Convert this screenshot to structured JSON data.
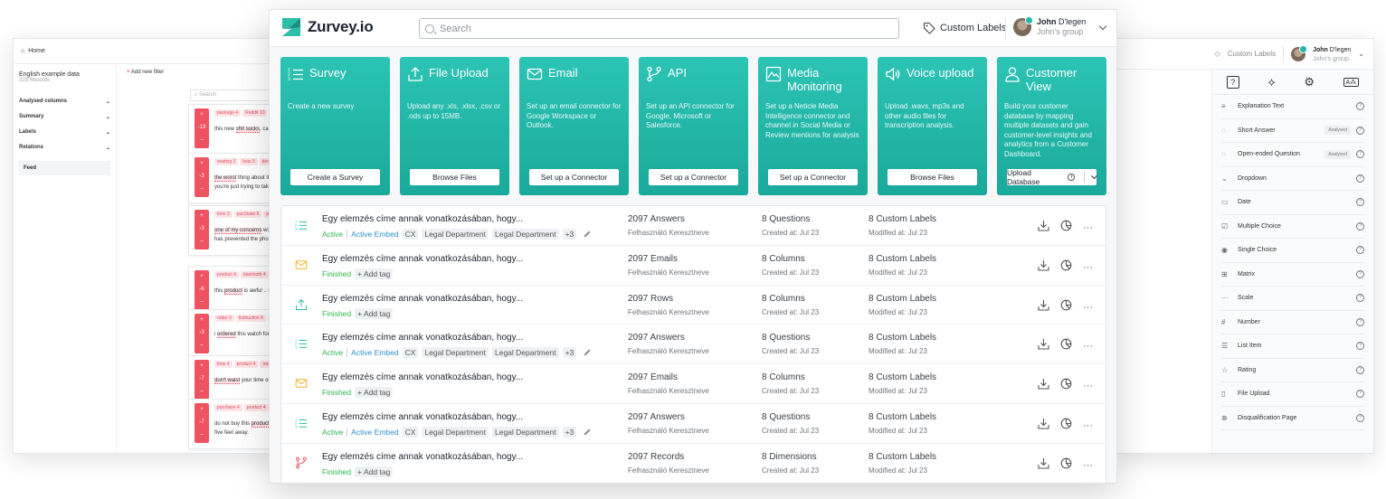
{
  "colors": {
    "accent": "#1fb5a5",
    "active": "#2db84b",
    "embed": "#2b8fd6",
    "danger": "#ef5361"
  },
  "left_window": {
    "home": "Home",
    "dataset_name": "English example data",
    "dataset_count": "329 Records",
    "sections": [
      "Analysed columns",
      "Summary",
      "Labels",
      "Relations"
    ],
    "feed": "Feed",
    "add_filter": "Add new filter",
    "search_placeholder": "Search",
    "cards": [
      {
        "score": [
          "+",
          "-13",
          "–"
        ],
        "tags": [
          "package 4",
          "Reddit 10"
        ],
        "text": [
          "this new ",
          "shit sucks",
          ", can rea"
        ]
      },
      {
        "score": [
          "+",
          "-3",
          "–"
        ],
        "tags": [
          "seating 3",
          "loos 3",
          "downs"
        ],
        "text": [
          "the worst",
          " thing about it, the",
          "you're just trying to take it in"
        ]
      },
      {
        "score": [
          "+",
          "-3",
          "–"
        ],
        "tags": [
          "time 3",
          "purchase 6",
          "phon"
        ],
        "text": [
          "one of my concerns",
          " with th",
          "durable than my other phon",
          "has prevented the phone fr"
        ]
      },
      {
        "score": [
          "+",
          "-6",
          "–"
        ],
        "tags": [
          "product 4",
          "bluetooth 4",
          "d"
        ],
        "text": [
          "this ",
          "product",
          " is awful .. it do"
        ]
      },
      {
        "score": [
          "+",
          "-3",
          "–"
        ],
        "tags": [
          "order 3",
          "instruction 4",
          "fou"
        ],
        "text": [
          "i ",
          "ordered",
          " this watch for my f"
        ]
      },
      {
        "score": [
          "+",
          "-7",
          "–"
        ],
        "tags": [
          "time 4",
          "product 4",
          "money"
        ],
        "text": [
          "don't waist",
          " your ",
          "time",
          " or mo"
        ]
      },
      {
        "score": [
          "+",
          "-7",
          "–"
        ],
        "tags": [
          "purchase 4",
          "product 4",
          "je"
        ],
        "text": [
          "do not buy this ",
          "product!!",
          " c",
          "five feet away."
        ]
      }
    ]
  },
  "right_window": {
    "custom_labels": "Custom Labels",
    "user_first": "John",
    "user_last": "D'legen",
    "user_group": "John's group",
    "items": [
      {
        "icon": "≡",
        "label": "Explanation Text",
        "badge": ""
      },
      {
        "icon": "◌",
        "label": "Short Answer",
        "badge": "Analysed"
      },
      {
        "icon": "◌",
        "label": "Open-ended Question",
        "badge": "Analysed"
      },
      {
        "icon": "⌄",
        "label": "Dropdown",
        "badge": ""
      },
      {
        "icon": "▭",
        "label": "Date",
        "badge": ""
      },
      {
        "icon": "☑",
        "label": "Multiple Choice",
        "badge": ""
      },
      {
        "icon": "◉",
        "label": "Single Choice",
        "badge": ""
      },
      {
        "icon": "⊞",
        "label": "Matrix",
        "badge": ""
      },
      {
        "icon": "···",
        "label": "Scale",
        "badge": ""
      },
      {
        "icon": "#",
        "label": "Number",
        "badge": ""
      },
      {
        "icon": "☰",
        "label": "List Item",
        "badge": ""
      },
      {
        "icon": "☆",
        "label": "Rating",
        "badge": ""
      },
      {
        "icon": "▯",
        "label": "File Upload",
        "badge": ""
      },
      {
        "icon": "⊗",
        "label": "Disqualification Page",
        "badge": ""
      }
    ]
  },
  "header": {
    "logo": "Zurvey.io",
    "search_placeholder": "Search",
    "custom_labels": "Custom Labels",
    "user_first": "John",
    "user_last": " D'legen",
    "user_group": "John's group"
  },
  "tiles": [
    {
      "icon": "list-icon",
      "title": "Survey",
      "desc": "Create a new survey",
      "button": "Create a Survey"
    },
    {
      "icon": "upload-icon",
      "title": "File Upload",
      "desc": "Upload any .xls, .xlsx, .csv or .ods up to 15MB.",
      "button": "Browse Files"
    },
    {
      "icon": "mail-icon",
      "title": "Email",
      "desc": "Set up an email connector for Google Workspace or Outlook.",
      "button": "Set up a Connector"
    },
    {
      "icon": "api-icon",
      "title": "API",
      "desc": "Set up an API connector for Google, Microsoft or Salesforce.",
      "button": "Set up a Connector"
    },
    {
      "icon": "media-icon",
      "title": "Media Monitoring",
      "desc": "Set up a Neticle Media Intelligence connector and channel in Social Media or Review mentions for analysis",
      "button": "Set up a Connector"
    },
    {
      "icon": "voice-icon",
      "title": "Voice upload",
      "desc": "Upload .wavs, mp3s and other audio files for transcription analysis.",
      "button": "Browse Files"
    },
    {
      "icon": "customer-icon",
      "title": "Customer View",
      "desc": "Build your customer database by mapping multiple datasets and gain customer-level insights and analytics from a Customer Dashboard.",
      "button": "Upload Database"
    }
  ],
  "rows": [
    {
      "icon": "list-icon",
      "title": "Egy elemzés címe annak vonatkozásában, hogy...",
      "status": "Active",
      "embed": "Active Embed",
      "tags": [
        "CX",
        "Legal Department",
        "Legal Department"
      ],
      "more_tags": "+3",
      "add_tag": "",
      "count": "2097 Answers",
      "owner": "Felhasználó Keresztneve",
      "dims": "8 Questions",
      "created": "Created at: Jul 23",
      "labels": "8 Custom Labels",
      "modified": "Modified at: Jul 23"
    },
    {
      "icon": "mail-icon",
      "title": "Egy elemzés címe annak vonatkozásában, hogy...",
      "status": "Finished",
      "embed": "",
      "tags": [],
      "more_tags": "",
      "add_tag": "+ Add tag",
      "count": "2097 Emails",
      "owner": "Felhasználó Keresztneve",
      "dims": "8 Columns",
      "created": "Created at: Jul 23",
      "labels": "8 Custom Labels",
      "modified": "Modified at: Jul 23"
    },
    {
      "icon": "upload-icon",
      "title": "Egy elemzés címe annak vonatkozásában, hogy...",
      "status": "Finished",
      "embed": "",
      "tags": [],
      "more_tags": "",
      "add_tag": "+ Add tag",
      "count": "2097 Rows",
      "owner": "Felhasználó Keresztneve",
      "dims": "8 Columns",
      "created": "Created at: Jul 23",
      "labels": "8 Custom Labels",
      "modified": "Modified at: Jul 23"
    },
    {
      "icon": "list-icon",
      "title": "Egy elemzés címe annak vonatkozásában, hogy...",
      "status": "Active",
      "embed": "Active Embed",
      "tags": [
        "CX",
        "Legal Department",
        "Legal Department"
      ],
      "more_tags": "+3",
      "add_tag": "",
      "count": "2097 Answers",
      "owner": "Felhasználó Keresztneve",
      "dims": "8 Questions",
      "created": "Created at: Jul 23",
      "labels": "8 Custom Labels",
      "modified": "Modified at: Jul 23"
    },
    {
      "icon": "mail-icon",
      "title": "Egy elemzés címe annak vonatkozásában, hogy...",
      "status": "Finished",
      "embed": "",
      "tags": [],
      "more_tags": "",
      "add_tag": "+ Add tag",
      "count": "2097 Emails",
      "owner": "Felhasználó Keresztneve",
      "dims": "8 Columns",
      "created": "Created at: Jul 23",
      "labels": "8 Custom Labels",
      "modified": "Modified at: Jul 23"
    },
    {
      "icon": "list-icon",
      "title": "Egy elemzés címe annak vonatkozásában, hogy...",
      "status": "Active",
      "embed": "Active Embed",
      "tags": [
        "CX",
        "Legal Department",
        "Legal Department"
      ],
      "more_tags": "+3",
      "add_tag": "",
      "count": "2097 Answers",
      "owner": "Felhasználó Keresztneve",
      "dims": "8 Questions",
      "created": "Created at: Jul 23",
      "labels": "8 Custom Labels",
      "modified": "Modified at: Jul 23"
    },
    {
      "icon": "api-icon",
      "title": "Egy elemzés címe annak vonatkozásában, hogy...",
      "status": "Finished",
      "embed": "",
      "tags": [],
      "more_tags": "",
      "add_tag": "+ Add tag",
      "count": "2097 Records",
      "owner": "Felhasználó Keresztneve",
      "dims": "8 Dimensions",
      "created": "Created at: Jul 23",
      "labels": "8 Custom Labels",
      "modified": "Modified at: Jul 23"
    }
  ]
}
